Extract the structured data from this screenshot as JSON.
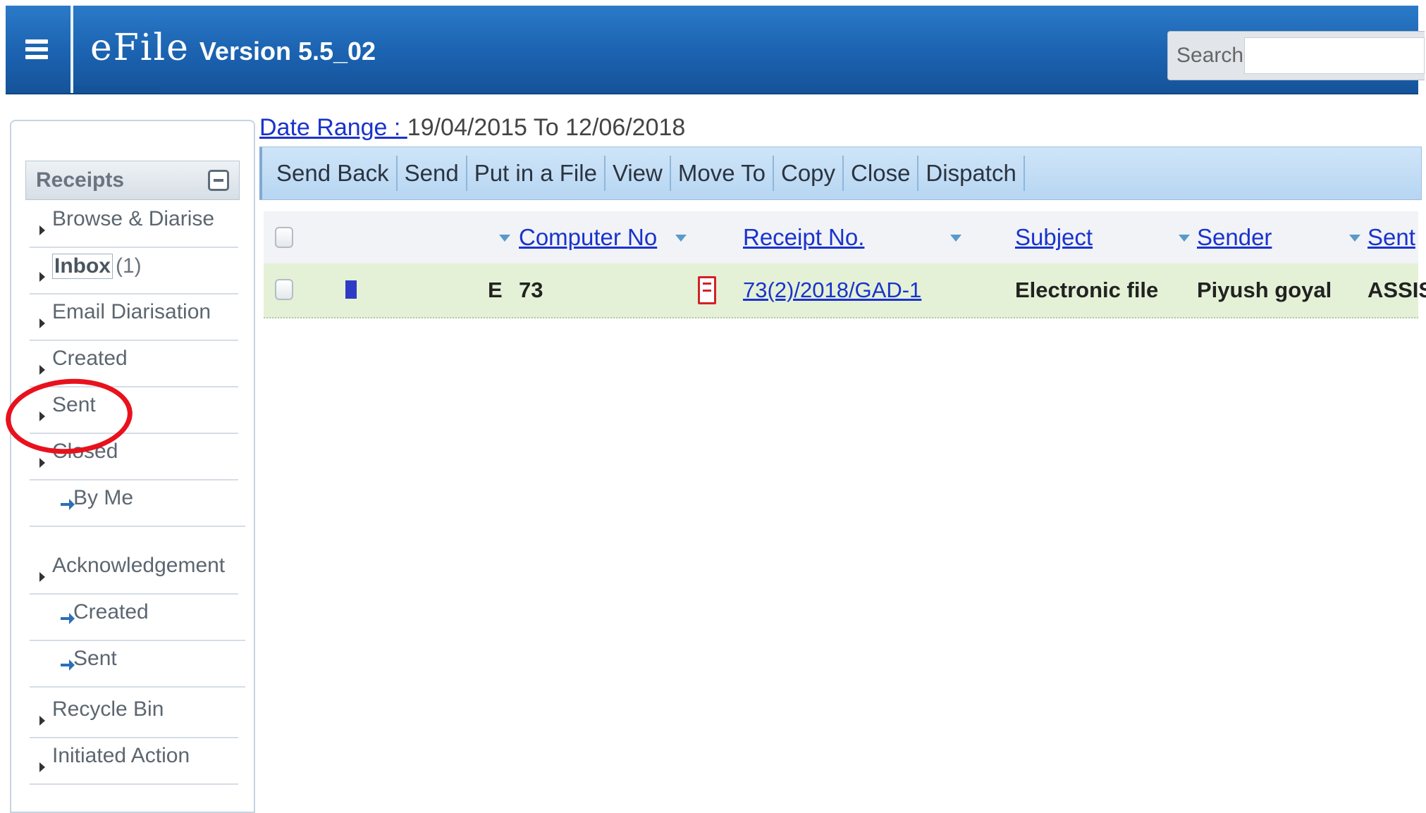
{
  "header": {
    "brand": "eFile",
    "version": "Version 5.5_02",
    "search_label": "Search",
    "search_value": ""
  },
  "sidebar": {
    "section_title": "Receipts",
    "items": [
      {
        "label": "Browse & Diarise"
      },
      {
        "label": "Inbox",
        "count": "(1)"
      },
      {
        "label": "Email Diarisation"
      },
      {
        "label": "Created"
      },
      {
        "label": "Sent"
      },
      {
        "label": "Closed"
      },
      {
        "label": "By Me"
      },
      {
        "label": "Acknowledgement"
      },
      {
        "label": "Created"
      },
      {
        "label": "Sent"
      },
      {
        "label": "Recycle Bin"
      },
      {
        "label": "Initiated Action"
      }
    ]
  },
  "main": {
    "date_range_label": "Date Range : ",
    "date_range_value": "19/04/2015 To 12/06/2018",
    "toolbar": [
      "Send Back",
      "Send",
      "Put in a File",
      "View",
      "Move To",
      "Copy",
      "Close",
      "Dispatch"
    ],
    "columns": [
      "Computer No",
      "Receipt No.",
      "Subject",
      "Sender",
      "Sent"
    ],
    "rows": [
      {
        "type": "E",
        "computer_no": "73",
        "receipt_no": "73(2)/2018/GAD-1",
        "subject": "Electronic file",
        "sender": "Piyush goyal",
        "sent": "ASSIS"
      }
    ]
  },
  "colors": {
    "header_blue": "#1b62b0",
    "link_blue": "#1a33cc",
    "row_highlight": "#e4f1d6",
    "annotation_red": "#e8111d"
  }
}
